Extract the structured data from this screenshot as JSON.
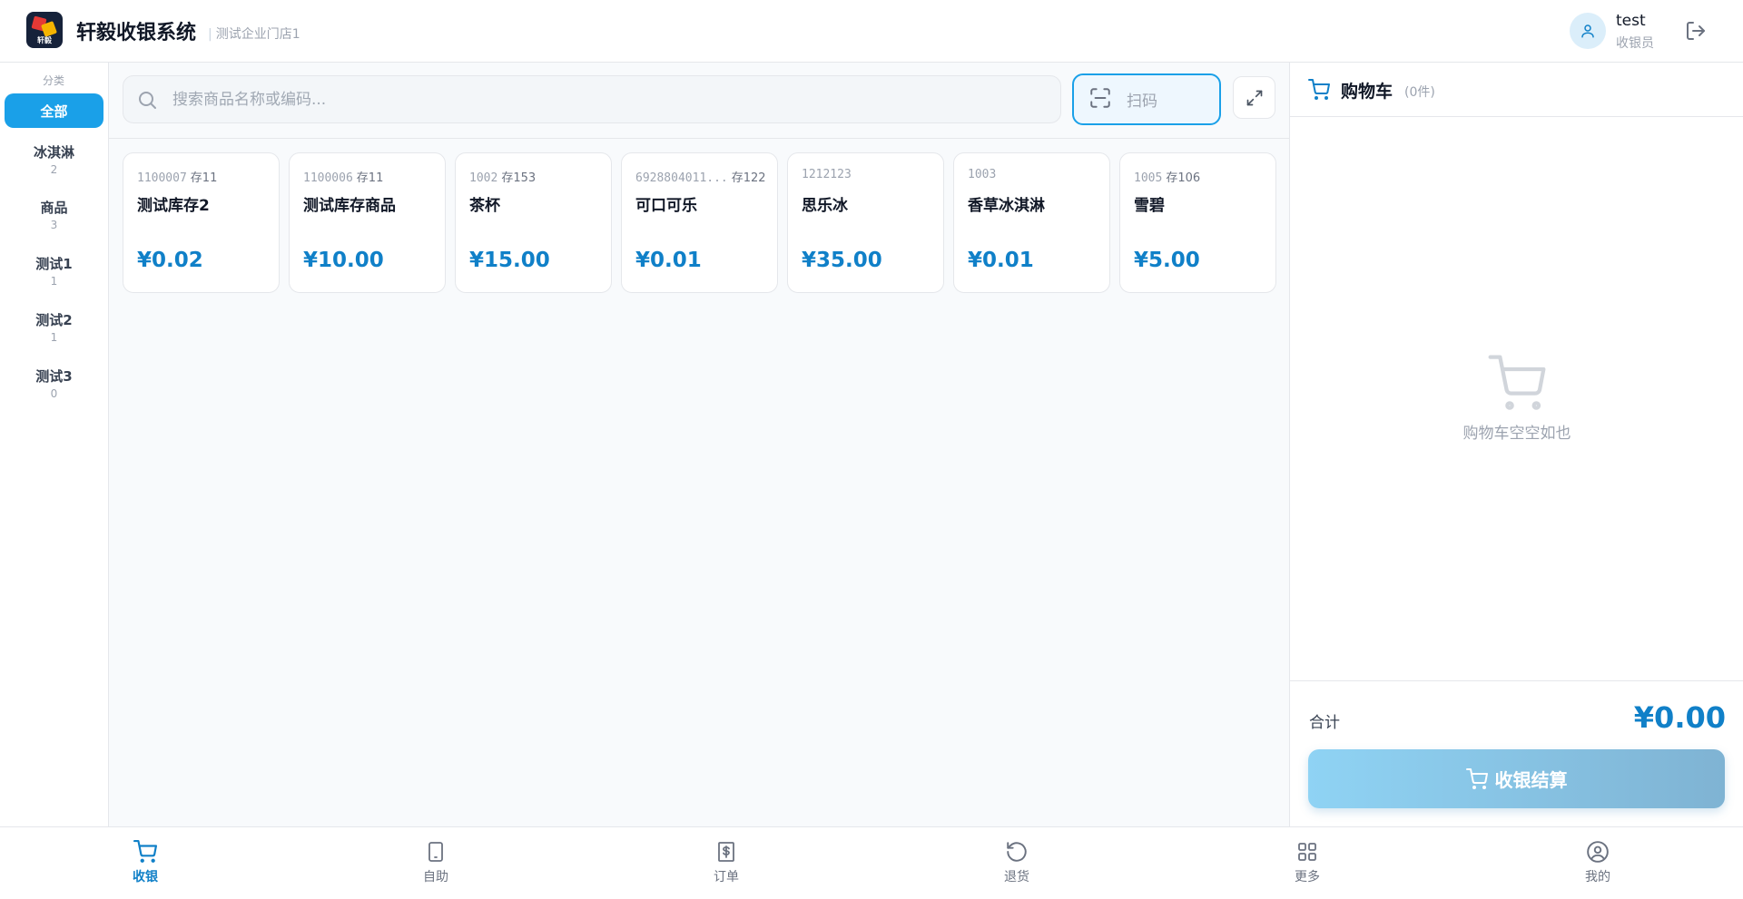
{
  "header": {
    "logo_text": "轩毅",
    "app_title": "轩毅收银系统",
    "separator": "|",
    "store_name": "测试企业门店1",
    "user_name": "test",
    "user_role": "收银员"
  },
  "categories": {
    "title": "分类",
    "items": [
      {
        "name": "全部",
        "count": ""
      },
      {
        "name": "冰淇淋",
        "count": "2"
      },
      {
        "name": "商品",
        "count": "3"
      },
      {
        "name": "测试1",
        "count": "1"
      },
      {
        "name": "测试2",
        "count": "1"
      },
      {
        "name": "测试3",
        "count": "0"
      }
    ]
  },
  "search": {
    "placeholder": "搜索商品名称或编码...",
    "scan_label": "扫码"
  },
  "products": [
    {
      "code": "1100007",
      "stock": "存11",
      "name": "测试库存2",
      "price": "¥0.02"
    },
    {
      "code": "1100006",
      "stock": "存11",
      "name": "测试库存商品",
      "price": "¥10.00"
    },
    {
      "code": "1002",
      "stock": "存153",
      "name": "茶杯",
      "price": "¥15.00"
    },
    {
      "code": "6928804011...",
      "stock": "存122",
      "name": "可口可乐",
      "price": "¥0.01"
    },
    {
      "code": "1212123",
      "stock": "",
      "name": "思乐冰",
      "price": "¥35.00"
    },
    {
      "code": "1003",
      "stock": "",
      "name": "香草冰淇淋",
      "price": "¥0.01"
    },
    {
      "code": "1005",
      "stock": "存106",
      "name": "雪碧",
      "price": "¥5.00"
    }
  ],
  "cart": {
    "title": "购物车",
    "count": "(0件)",
    "empty_text": "购物车空空如也",
    "total_label": "合计",
    "total_value": "¥0.00",
    "checkout_label": "收银结算"
  },
  "bottom_nav": [
    {
      "label": "收银",
      "icon": "cart-icon"
    },
    {
      "label": "自助",
      "icon": "tablet-icon"
    },
    {
      "label": "订单",
      "icon": "receipt-icon"
    },
    {
      "label": "退货",
      "icon": "undo-icon"
    },
    {
      "label": "更多",
      "icon": "grid-icon"
    },
    {
      "label": "我的",
      "icon": "user-circle-icon"
    }
  ],
  "colors": {
    "accent": "#1aa0e8",
    "price": "#1080c8"
  }
}
